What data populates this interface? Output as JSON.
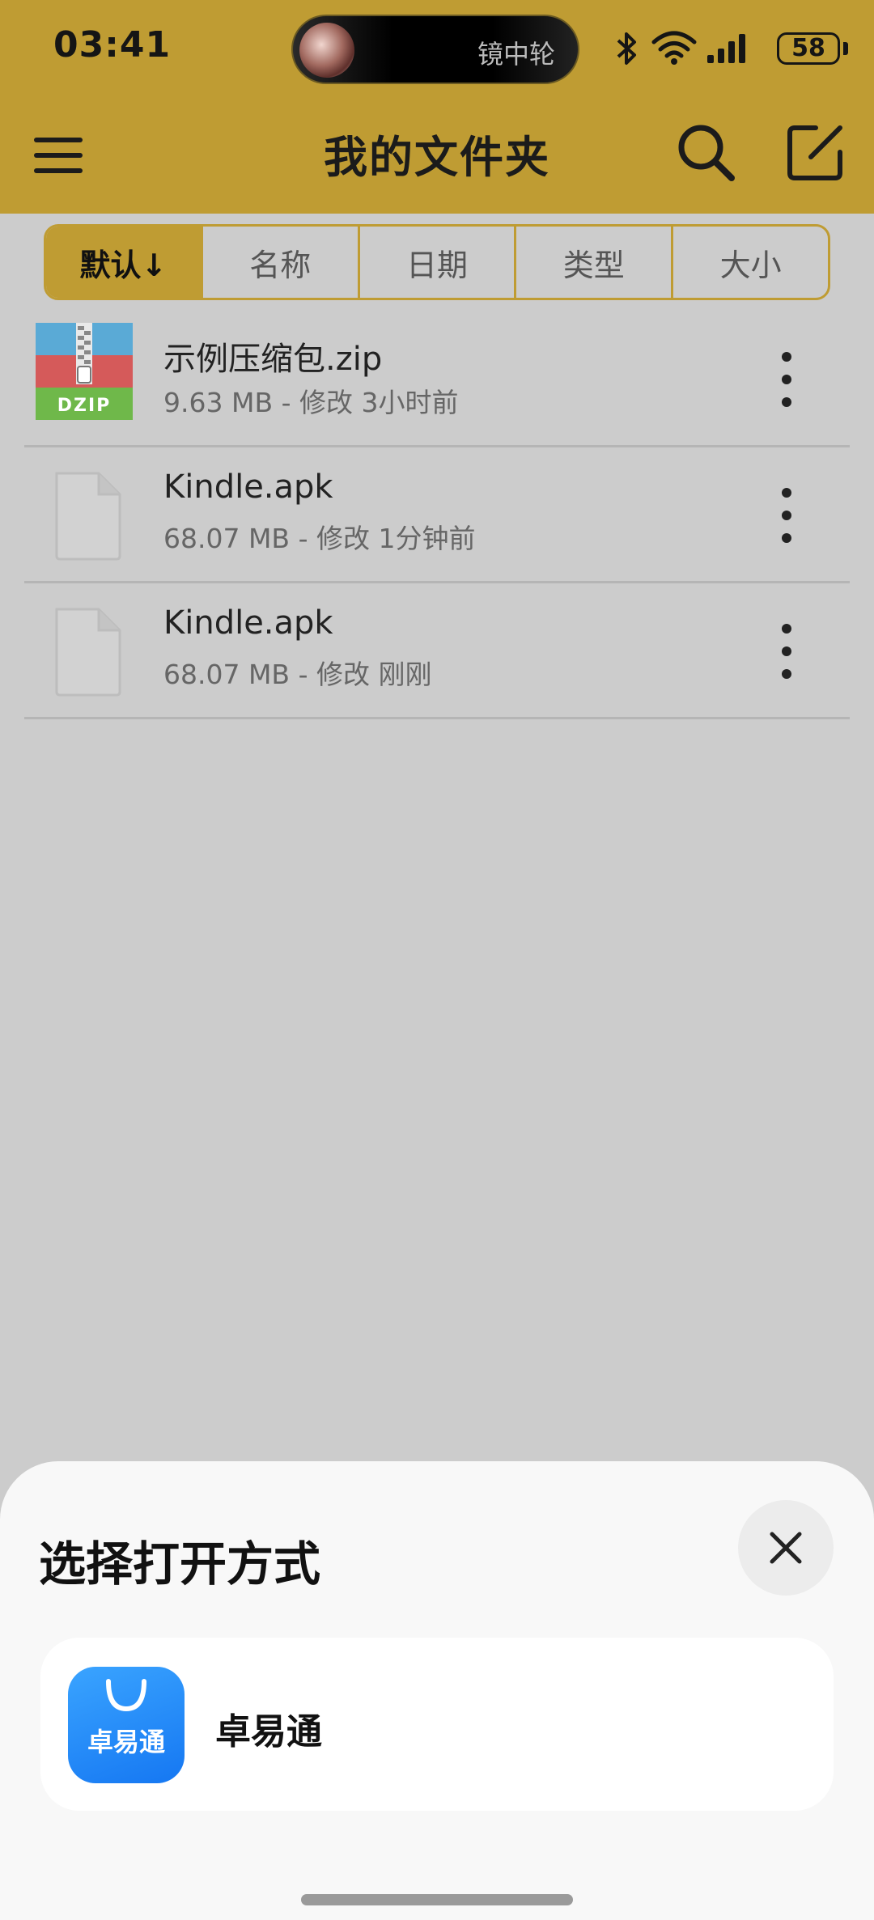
{
  "status_bar": {
    "time": "03:41",
    "island_text": "镜中轮",
    "battery": "58",
    "icons": [
      "bluetooth-icon",
      "wifi-icon",
      "signal-icon",
      "battery-icon"
    ]
  },
  "app_bar": {
    "title": "我的文件夹",
    "menu_icon": "menu-icon",
    "search_icon": "search-icon",
    "edit_icon": "edit-icon"
  },
  "sort_tabs": [
    {
      "label": "默认↓",
      "active": true
    },
    {
      "label": "名称",
      "active": false
    },
    {
      "label": "日期",
      "active": false
    },
    {
      "label": "类型",
      "active": false
    },
    {
      "label": "大小",
      "active": false
    }
  ],
  "files": [
    {
      "name": "示例压缩包.zip",
      "meta": "9.63 MB - 修改 3小时前",
      "icon": "zip-file-icon",
      "icon_label": "DZIP"
    },
    {
      "name": "Kindle.apk",
      "meta": "68.07 MB - 修改 1分钟前",
      "icon": "file-icon"
    },
    {
      "name": "Kindle.apk",
      "meta": "68.07 MB - 修改 刚刚",
      "icon": "file-icon"
    }
  ],
  "sheet": {
    "title": "选择打开方式",
    "close_icon": "close-icon",
    "apps": [
      {
        "name": "卓易通",
        "icon_label": "卓易通"
      }
    ]
  },
  "colors": {
    "accent": "#bf9c33",
    "background": "#cccccc",
    "sheet": "#f8f8f8",
    "app_icon_blue": "#1577f2"
  }
}
